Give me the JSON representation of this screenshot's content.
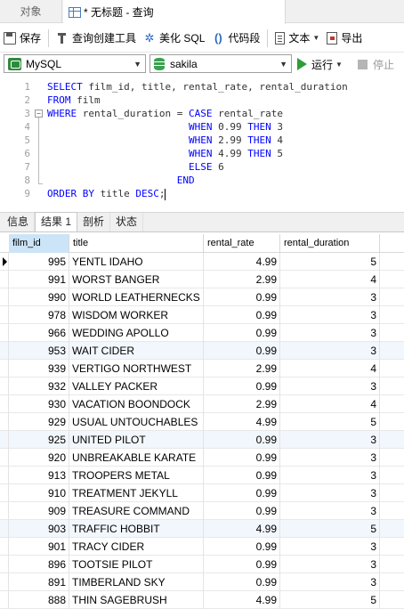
{
  "tabs": {
    "objects": "对象",
    "query": "* 无标题 - 查询"
  },
  "toolbar": {
    "save": "保存",
    "query_builder": "查询创建工具",
    "beautify": "美化 SQL",
    "code_snippet": "代码段",
    "text": "文本",
    "export": "导出"
  },
  "connection": {
    "engine": "MySQL",
    "database": "sakila",
    "run": "运行",
    "stop": "停止"
  },
  "editor": {
    "lines": [
      {
        "n": "1",
        "parts": [
          [
            "kw",
            "SELECT"
          ],
          [
            "t",
            " film_id, title, rental_rate, rental_duration"
          ]
        ]
      },
      {
        "n": "2",
        "parts": [
          [
            "kw",
            "FROM"
          ],
          [
            "t",
            " film"
          ]
        ]
      },
      {
        "n": "3",
        "parts": [
          [
            "kw",
            "WHERE"
          ],
          [
            "t",
            " rental_duration = "
          ],
          [
            "kw",
            "CASE"
          ],
          [
            "t",
            " rental_rate"
          ]
        ]
      },
      {
        "n": "4",
        "parts": [
          [
            "t",
            "                        "
          ],
          [
            "kw",
            "WHEN"
          ],
          [
            "t",
            " 0.99 "
          ],
          [
            "kw",
            "THEN"
          ],
          [
            "t",
            " 3"
          ]
        ]
      },
      {
        "n": "5",
        "parts": [
          [
            "t",
            "                        "
          ],
          [
            "kw",
            "WHEN"
          ],
          [
            "t",
            " 2.99 "
          ],
          [
            "kw",
            "THEN"
          ],
          [
            "t",
            " 4"
          ]
        ]
      },
      {
        "n": "6",
        "parts": [
          [
            "t",
            "                        "
          ],
          [
            "kw",
            "WHEN"
          ],
          [
            "t",
            " 4.99 "
          ],
          [
            "kw",
            "THEN"
          ],
          [
            "t",
            " 5"
          ]
        ]
      },
      {
        "n": "7",
        "parts": [
          [
            "t",
            "                        "
          ],
          [
            "kw",
            "ELSE"
          ],
          [
            "t",
            " 6"
          ]
        ]
      },
      {
        "n": "8",
        "parts": [
          [
            "t",
            "                      "
          ],
          [
            "kw",
            "END"
          ]
        ]
      },
      {
        "n": "9",
        "parts": [
          [
            "kw",
            "ORDER BY"
          ],
          [
            "t",
            " title "
          ],
          [
            "kw",
            "DESC"
          ],
          [
            "t",
            ";"
          ]
        ]
      }
    ]
  },
  "result_tabs": [
    "信息",
    "结果 1",
    "剖析",
    "状态"
  ],
  "grid": {
    "columns": [
      "film_id",
      "title",
      "rental_rate",
      "rental_duration"
    ],
    "rows": [
      [
        "995",
        "YENTL IDAHO",
        "4.99",
        "5"
      ],
      [
        "991",
        "WORST BANGER",
        "2.99",
        "4"
      ],
      [
        "990",
        "WORLD LEATHERNECKS",
        "0.99",
        "3"
      ],
      [
        "978",
        "WISDOM WORKER",
        "0.99",
        "3"
      ],
      [
        "966",
        "WEDDING APOLLO",
        "0.99",
        "3"
      ],
      [
        "953",
        "WAIT CIDER",
        "0.99",
        "3"
      ],
      [
        "939",
        "VERTIGO NORTHWEST",
        "2.99",
        "4"
      ],
      [
        "932",
        "VALLEY PACKER",
        "0.99",
        "3"
      ],
      [
        "930",
        "VACATION BOONDOCK",
        "2.99",
        "4"
      ],
      [
        "929",
        "USUAL UNTOUCHABLES",
        "4.99",
        "5"
      ],
      [
        "925",
        "UNITED PILOT",
        "0.99",
        "3"
      ],
      [
        "920",
        "UNBREAKABLE KARATE",
        "0.99",
        "3"
      ],
      [
        "913",
        "TROOPERS METAL",
        "0.99",
        "3"
      ],
      [
        "910",
        "TREATMENT JEKYLL",
        "0.99",
        "3"
      ],
      [
        "909",
        "TREASURE COMMAND",
        "0.99",
        "3"
      ],
      [
        "903",
        "TRAFFIC HOBBIT",
        "4.99",
        "5"
      ],
      [
        "901",
        "TRACY CIDER",
        "0.99",
        "3"
      ],
      [
        "896",
        "TOOTSIE PILOT",
        "0.99",
        "3"
      ],
      [
        "891",
        "TIMBERLAND SKY",
        "0.99",
        "3"
      ],
      [
        "888",
        "THIN SAGEBRUSH",
        "4.99",
        "5"
      ]
    ]
  }
}
